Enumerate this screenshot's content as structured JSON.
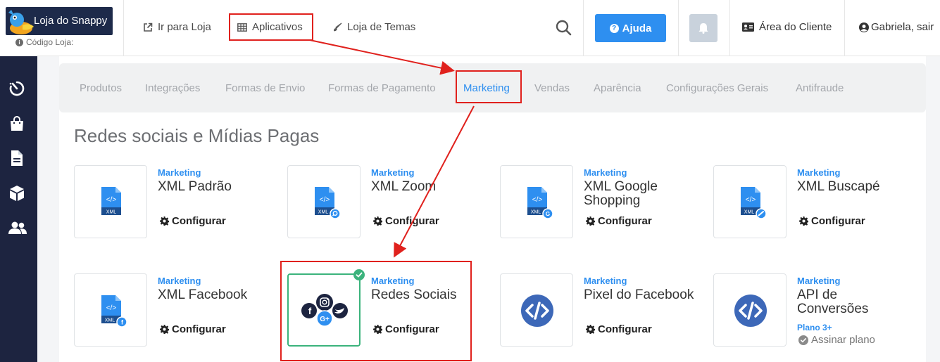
{
  "header": {
    "brand": {
      "logo_text": "Loja do Snappy",
      "store_code_label": "Código Loja:"
    },
    "nav": {
      "go_to_store": "Ir para Loja",
      "apps": "Aplicativos",
      "themes": "Loja de Temas"
    },
    "help_label": "Ajuda",
    "client_area": "Área do Cliente",
    "user": "Gabriela, sair"
  },
  "tabs": [
    "Produtos",
    "Integrações",
    "Formas de Envio",
    "Formas de Pagamento",
    "Marketing",
    "Vendas",
    "Aparência",
    "Configurações Gerais",
    "Antifraude"
  ],
  "active_tab": "Marketing",
  "section_title": "Redes sociais e Mídias Pagas",
  "configure_label": "Configurar",
  "apps": [
    {
      "category": "Marketing",
      "title": "XML Padrão"
    },
    {
      "category": "Marketing",
      "title": "XML Zoom"
    },
    {
      "category": "Marketing",
      "title": "XML Google Shopping"
    },
    {
      "category": "Marketing",
      "title": "XML Buscapé"
    },
    {
      "category": "Marketing",
      "title": "XML Facebook"
    },
    {
      "category": "Marketing",
      "title": "Redes Sociais",
      "installed": true
    },
    {
      "category": "Marketing",
      "title": "Pixel do Facebook"
    },
    {
      "category": "Marketing",
      "title": "API de Conversões",
      "plan": "Plano 3+",
      "subscribe_label": "Assinar plano"
    }
  ],
  "colors": {
    "accent": "#2e8ff0",
    "sidebar": "#1d2440",
    "annotation": "#e0211d",
    "installed": "#3bb37c"
  }
}
